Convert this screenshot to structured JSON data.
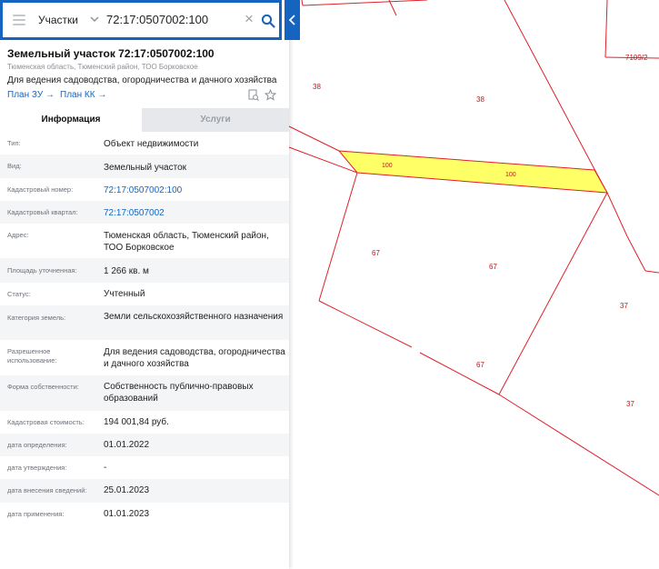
{
  "search": {
    "layer": "Участки",
    "query": "72:17:0507002:100"
  },
  "object": {
    "title": "Земельный участок 72:17:0507002:100",
    "address": "Тюменская область, Тюменский район, ТОО Борковское",
    "permitted_use": "Для ведения садоводства, огородничества и дачного хозяйства",
    "links": {
      "plan_zu": "План ЗУ →",
      "plan_kk": "План КК →"
    }
  },
  "tabs": {
    "info": "Информация",
    "services": "Услуги"
  },
  "attributes": [
    {
      "label": "Тип:",
      "value": "Объект недвижимости"
    },
    {
      "label": "Вид:",
      "value": "Земельный участок"
    },
    {
      "label": "Кадастровый номер:",
      "value": "72:17:0507002:100"
    },
    {
      "label": "Кадастровый квартал:",
      "value": "72:17:0507002"
    },
    {
      "label": "Адрес:",
      "value": "Тюменская область, Тюменский район, ТОО Борковское"
    },
    {
      "label": "Площадь уточненная:",
      "value": "1 266 кв. м"
    },
    {
      "label": "Статус:",
      "value": "Учтенный"
    },
    {
      "label": "Категория земель:",
      "value": "Земли сельскохозяйственного назначения"
    },
    {
      "label": "Разрешенное использование:",
      "value": "Для ведения садоводства, огородничества и дачного хозяйства"
    },
    {
      "label": "Форма собственности:",
      "value": "Собственность публично-правовых образований"
    },
    {
      "label": "Кадастровая стоимость:",
      "value": "194 001,84 руб."
    },
    {
      "label": "дата определения:",
      "value": "01.01.2022"
    },
    {
      "label": "дата утверждения:",
      "value": "-"
    },
    {
      "label": "дата внесения сведений:",
      "value": "25.01.2023"
    },
    {
      "label": "дата применения:",
      "value": "01.01.2023"
    }
  ],
  "map": {
    "labels": [
      "7109/2",
      "38",
      "38",
      "100",
      "100",
      "67",
      "67",
      "67",
      "37",
      "37"
    ],
    "parcel_line_color": "#e0202a",
    "selected_fill_color": "#ffff66"
  },
  "colors": {
    "accent": "#1565c0"
  }
}
